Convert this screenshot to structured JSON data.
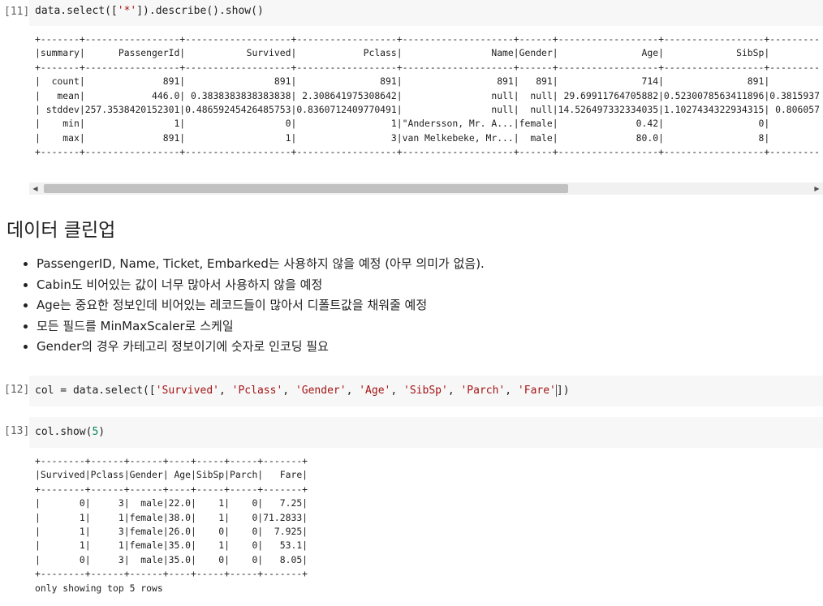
{
  "cells": [
    {
      "count": "[11]",
      "code": {
        "pre": "data.select([",
        "s1": "'*'",
        "post": "]).describe().show()"
      },
      "output_lines": [
        "+-------+-----------------+-------------------+------------------+--------------------+------+------------------+------------------+---------",
        "|summary|      PassengerId|           Survived|            Pclass|                Name|Gender|               Age|             SibSp|         ",
        "+-------+-----------------+-------------------+------------------+--------------------+------+------------------+------------------+---------",
        "|  count|              891|                891|               891|                 891|   891|               714|               891|         ",
        "|   mean|            446.0| 0.3838383838383838| 2.308641975308642|                null|  null| 29.69911764705882|0.5230078563411896|0.3815937",
        "| stddev|257.3538420152301|0.48659245426485753|0.8360712409770491|                null|  null|14.526497332334035|1.1027434322934315| 0.806057",
        "|    min|                1|                  0|                 1|\"Andersson, Mr. A...|female|              0.42|                 0|         ",
        "|    max|              891|                  1|                 3|van Melkebeke, Mr...|  male|              80.0|                 8|         ",
        "+-------+-----------------+-------------------+------------------+--------------------+------+------------------+------------------+---------"
      ]
    },
    {
      "count": "[12]",
      "code": {
        "pre": "col = data.select([",
        "args": [
          "'Survived'",
          "'Pclass'",
          "'Gender'",
          "'Age'",
          "'SibSp'",
          "'Parch'",
          "'Fare'"
        ],
        "post": "])"
      }
    },
    {
      "count": "[13]",
      "code": {
        "pre": "col.show(",
        "num": "5",
        "post": ")"
      },
      "output_lines": [
        "+--------+------+------+----+-----+-----+-------+",
        "|Survived|Pclass|Gender| Age|SibSp|Parch|   Fare|",
        "+--------+------+------+----+-----+-----+-------+",
        "|       0|     3|  male|22.0|    1|    0|   7.25|",
        "|       1|     1|female|38.0|    1|    0|71.2833|",
        "|       1|     3|female|26.0|    0|    0|  7.925|",
        "|       1|     1|female|35.0|    1|    0|   53.1|",
        "|       0|     3|  male|35.0|    0|    0|   8.05|",
        "+--------+------+------+----+-----+-----+-------+",
        "only showing top 5 rows"
      ]
    }
  ],
  "markdown": {
    "heading": "데이터 클린업",
    "items": [
      "PassengerID, Name, Ticket, Embarked는 사용하지 않을 예정 (아무 의미가 없음).",
      "Cabin도 비어있는 값이 너무 많아서 사용하지 않을 예정",
      "Age는 중요한 정보인데 비어있는 레코드들이 많아서 디폴트값을 채워줄 예정",
      "모든 필드를 MinMaxScaler로 스케일",
      "Gender의 경우 카테고리 정보이기에 숫자로 인코딩 필요"
    ]
  },
  "icons": {
    "scroll_left": "◀",
    "scroll_right": "▶"
  }
}
